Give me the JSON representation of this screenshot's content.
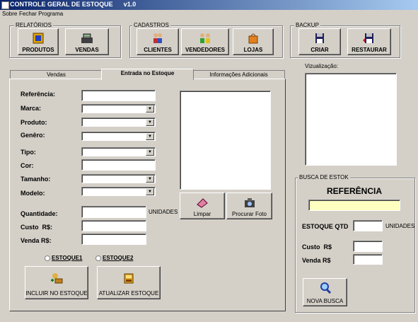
{
  "window": {
    "title": "CONTROLE GERAL DE ESTOQUE      v1.0"
  },
  "menu": {
    "items": [
      "Sobre",
      "Fechar Programa"
    ]
  },
  "groups": {
    "relatorios": {
      "label": "RELATÓRIOS",
      "buttons": [
        "PRODUTOS",
        "VENDAS"
      ]
    },
    "cadastros": {
      "label": "CADASTROS",
      "buttons": [
        "CLIENTES",
        "VENDEDORES",
        "LOJAS"
      ]
    },
    "backup": {
      "label": "BACKUP",
      "buttons": [
        "CRIAR",
        "RESTAURAR"
      ]
    }
  },
  "tabs": [
    {
      "label": "Vendas",
      "active": false
    },
    {
      "label": "Entrada no Estoque",
      "active": true
    },
    {
      "label": "Informações Adicionais",
      "active": false
    }
  ],
  "form": {
    "referencia": "Referência:",
    "marca": "Marca:",
    "produto": "Produto:",
    "genero": "Genêro:",
    "tipo": "Tipo:",
    "cor": "Cor:",
    "tamanho": "Tamanho:",
    "modelo": "Modelo:",
    "quantidade": "Quantidade:",
    "unidades": "UNIDADES",
    "custo": "Custo  R$:",
    "venda": "Venda R$:",
    "limpar": "Limpar",
    "procurar_foto": "Procurar Foto",
    "estoque1": "ESTOQUE1",
    "estoque2": "ESTOQUE2",
    "incluir": "INCLUIR NO ESTOQUE",
    "atualizar": "ATUALIZAR ESTOQUE"
  },
  "preview": {
    "label": "Vizualização:"
  },
  "busca": {
    "label": "BUSCA DE ESTOK",
    "heading": "REFERÊNCIA",
    "estoque_qtd": "ESTOQUE QTD",
    "unidades": "UNIDADES",
    "custo": "Custo  R$",
    "venda": "Venda R$",
    "nova_busca": "NOVA BUSCA"
  },
  "colors": {
    "titlebar_start": "#0a246a",
    "titlebar_end": "#a6caf0",
    "search_field": "#ffffc0",
    "face": "#d4d0c8"
  }
}
